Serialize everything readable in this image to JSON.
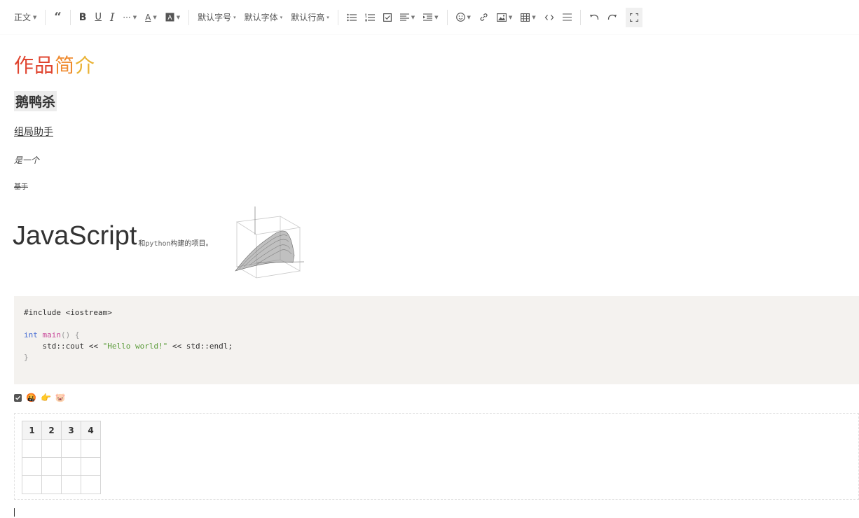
{
  "toolbar": {
    "paragraph": "正文",
    "font_size": "默认字号",
    "font_family": "默认字体",
    "line_height": "默认行高",
    "bold": "B",
    "underline": "U",
    "italic": "I",
    "more": "···",
    "font_color": "A",
    "icons": [
      "quote-icon",
      "bold-icon",
      "underline-icon",
      "italic-icon",
      "more-icon",
      "font-color-icon",
      "bg-color-icon",
      "bullet-list-icon",
      "numbered-list-icon",
      "todo-icon",
      "align-icon",
      "indent-icon",
      "emoji-icon",
      "link-icon",
      "image-icon",
      "table-icon",
      "code-icon",
      "divider-icon",
      "undo-icon",
      "redo-icon",
      "fullscreen-icon"
    ]
  },
  "doc": {
    "title_chars": [
      "作品",
      "简",
      "介"
    ],
    "subtitle": "鹅鸭杀",
    "underlined": "组局助手",
    "italic": "是一个",
    "strike": "基于",
    "big": "JavaScript",
    "small_pre": "和",
    "small_mono": "python",
    "small_post": "构建的项目。",
    "code": {
      "include": "#include <iostream>",
      "kw_int": "int",
      "fn_main": "main",
      "paren": "() {",
      "line3_pre": "    std::cout << ",
      "line3_str": "\"Hello world!\"",
      "line3_post": " << std::endl;",
      "close": "}"
    },
    "todo_emoji": [
      "🤬",
      "👉",
      "🐷"
    ],
    "table_header": [
      "1",
      "2",
      "3",
      "4"
    ],
    "table_rows": [
      [
        "",
        "",
        "",
        ""
      ],
      [
        "",
        "",
        "",
        ""
      ],
      [
        "",
        "",
        "",
        ""
      ]
    ]
  },
  "colors": {
    "title": [
      "#e04530",
      "#ef8a2e",
      "#e9b234"
    ],
    "code_bg": "#f4f2ef",
    "keyword": "#4a6fd4",
    "function": "#c94a9b",
    "string": "#5b9c3a"
  }
}
